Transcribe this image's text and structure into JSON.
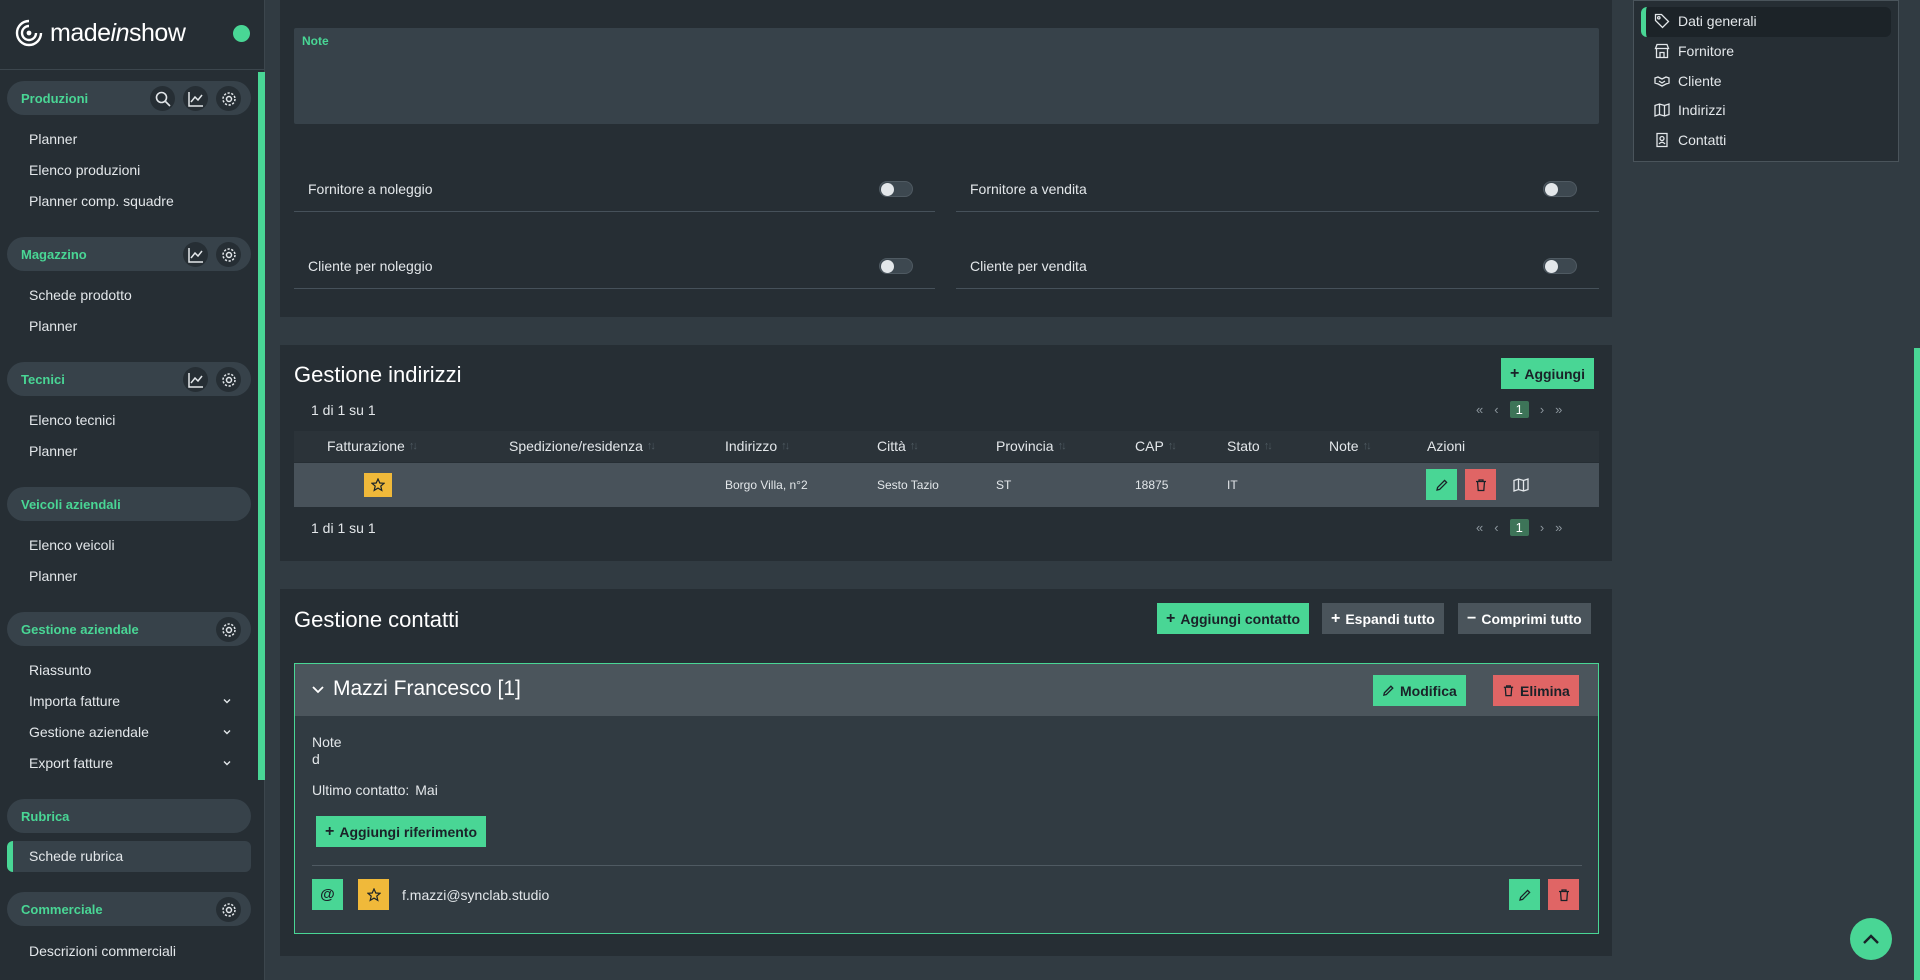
{
  "app": {
    "brand_prefix": "made",
    "brand_mid": "in",
    "brand_suffix": "show"
  },
  "sidebar": {
    "sections": [
      {
        "title": "Produzioni",
        "icons": [
          "search-icon",
          "chart-icon",
          "gear-icon"
        ],
        "items": [
          "Planner",
          "Elenco produzioni",
          "Planner comp. squadre"
        ]
      },
      {
        "title": "Magazzino",
        "icons": [
          "chart-icon",
          "gear-icon"
        ],
        "items": [
          "Schede prodotto",
          "Planner"
        ]
      },
      {
        "title": "Tecnici",
        "icons": [
          "chart-icon",
          "gear-icon"
        ],
        "items": [
          "Elenco tecnici",
          "Planner"
        ]
      },
      {
        "title": "Veicoli aziendali",
        "icons": [],
        "items": [
          "Elenco veicoli",
          "Planner"
        ]
      },
      {
        "title": "Gestione aziendale",
        "icons": [
          "gear-icon"
        ],
        "items": [
          "Riassunto",
          "Importa fatture",
          "Gestione aziendale",
          "Export fatture"
        ]
      },
      {
        "title": "Rubrica",
        "icons": [],
        "items": [
          "Schede rubrica"
        ]
      },
      {
        "title": "Commerciale",
        "icons": [
          "gear-icon"
        ],
        "items": [
          "Descrizioni commerciali"
        ]
      }
    ],
    "active_item": "Schede rubrica"
  },
  "general": {
    "note_label": "Note",
    "note_value": "",
    "toggles": [
      {
        "label": "Fornitore a noleggio",
        "on": false
      },
      {
        "label": "Fornitore a vendita",
        "on": false
      },
      {
        "label": "Cliente per noleggio",
        "on": false
      },
      {
        "label": "Cliente per vendita",
        "on": false
      }
    ]
  },
  "addresses": {
    "title": "Gestione indirizzi",
    "add_label": "Aggiungi",
    "pagination_text": "1 di 1 su 1",
    "current_page": "1",
    "columns": [
      "Fatturazione",
      "Spedizione/residenza",
      "Indirizzo",
      "Città",
      "Provincia",
      "CAP",
      "Stato",
      "Note",
      "Azioni"
    ],
    "rows": [
      {
        "fatturazione": "star-icon",
        "spedizione": "",
        "indirizzo": "Borgo Villa, n°2",
        "citta": "Sesto Tazio",
        "provincia": "ST",
        "cap": "18875",
        "stato": "IT",
        "note": ""
      }
    ]
  },
  "contacts": {
    "title": "Gestione contatti",
    "add_label": "Aggiungi contatto",
    "expand_label": "Espandi tutto",
    "collapse_label": "Comprimi tutto",
    "card": {
      "name": "Mazzi Francesco [1]",
      "edit_label": "Modifica",
      "delete_label": "Elimina",
      "note_label": "Note",
      "note_value": "d",
      "last_contact_label": "Ultimo contatto:",
      "last_contact_value": "Mai",
      "add_ref_label": "Aggiungi riferimento",
      "references": [
        {
          "type": "at-icon",
          "favorite": true,
          "value": "f.mazzi@synclab.studio"
        }
      ]
    }
  },
  "right_nav": {
    "items": [
      "Dati generali",
      "Fornitore",
      "Cliente",
      "Indirizzi",
      "Contatti"
    ],
    "active": "Dati generali"
  },
  "colors": {
    "accent": "#49d695",
    "danger": "#e06565",
    "warning": "#f0b93a",
    "background": "#313b42",
    "panel": "#262e34"
  }
}
